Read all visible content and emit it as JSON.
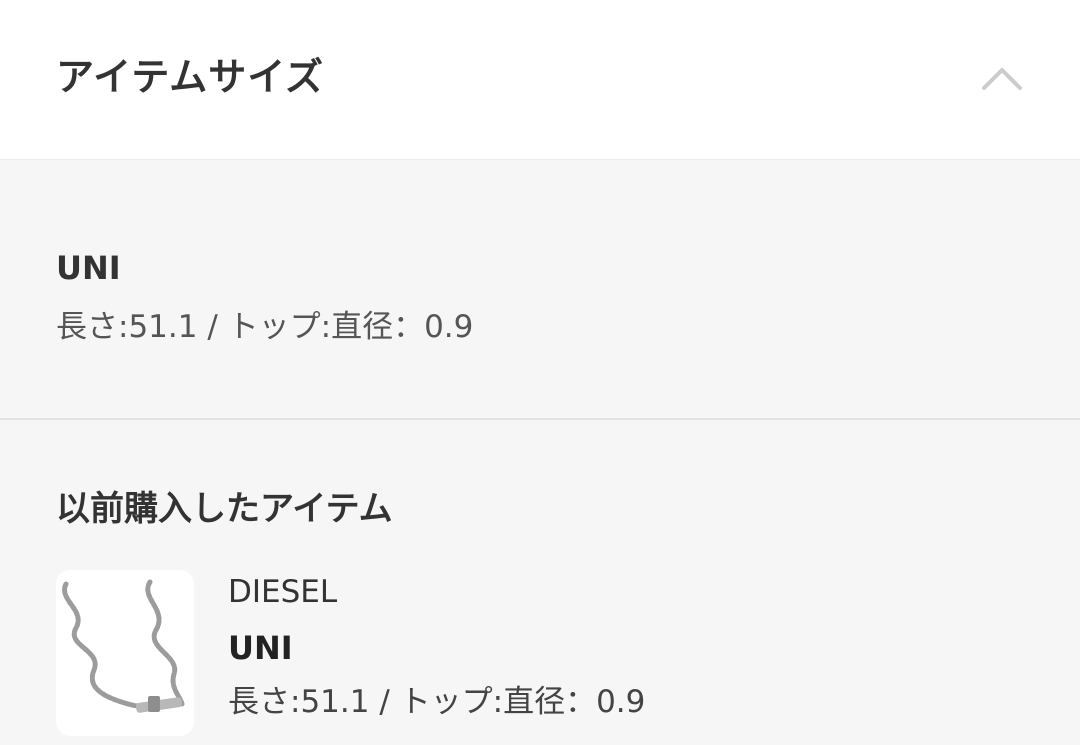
{
  "header": {
    "title": "アイテムサイズ",
    "toggle_icon": "chevron-up-icon"
  },
  "size": {
    "name": "UNI",
    "detail": "長さ:51.1 / トップ:直径：0.9"
  },
  "history": {
    "title": "以前購入したアイテム",
    "item": {
      "image": "necklace-thumbnail",
      "brand": "DIESEL",
      "size": "UNI",
      "detail": "長さ:51.1 / トップ:直径：0.9"
    }
  },
  "colors": {
    "page_background": "#f6f6f6",
    "header_background": "#ffffff",
    "text": "#333333",
    "chevron": "#cccccc",
    "divider": "#e3e3e3"
  }
}
